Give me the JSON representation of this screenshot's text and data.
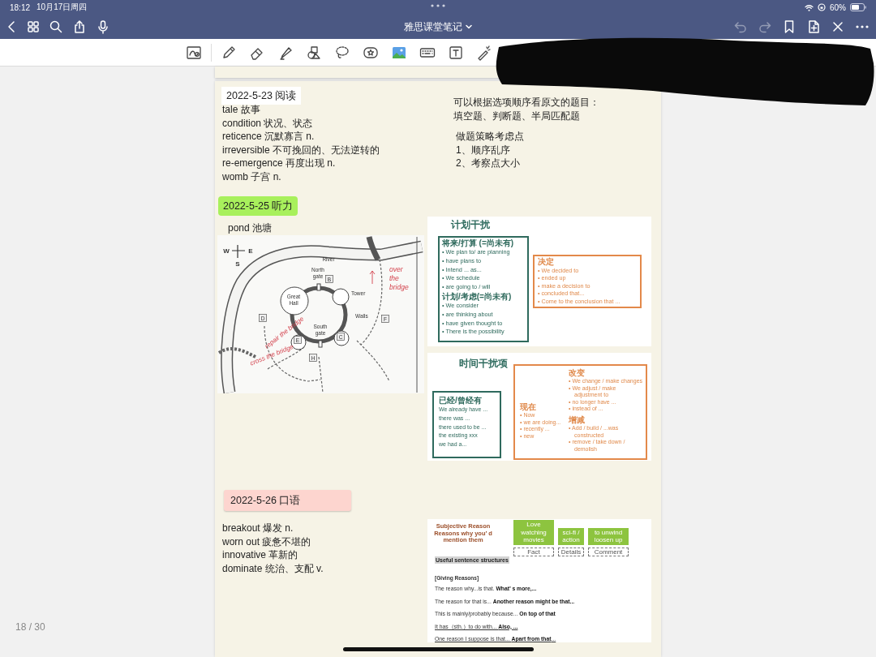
{
  "status_bar": {
    "time": "18:12",
    "date": "10月17日周四",
    "battery": "60%"
  },
  "nav_bar": {
    "title": "雅思课堂笔记",
    "undo": {
      "disabled": true
    },
    "redo": {
      "disabled": true
    }
  },
  "page_counter": "18 / 30",
  "reading": {
    "heading": "2022-5-23 阅读",
    "vocab": [
      "tale 故事",
      "condition 状况、状态",
      "reticence 沉默寡言 n.",
      "irreversible 不可挽回的、无法逆转的",
      "re-emergence 再度出现 n.",
      "womb 子宫 n."
    ],
    "tips": [
      "可以根据选项顺序看原文的题目：",
      "填空题、判断题、半局匹配题"
    ],
    "strategy": [
      "做题策略考虑点",
      "1、顺序乱序",
      "2、考察点大小"
    ]
  },
  "listening": {
    "heading": "2022-5-25 听力",
    "vocab": [
      "pond 池塘"
    ],
    "map": {
      "compass": [
        "W",
        "E",
        "S"
      ],
      "labels": [
        "River",
        "North gate",
        "Great Hall",
        "Tower",
        "Walls",
        "South gate"
      ],
      "markers": [
        "B",
        "C",
        "D",
        "E",
        "F",
        "H"
      ],
      "annotations": [
        "over the bridge",
        "repair the bridge",
        "cross the bridge"
      ]
    },
    "plan_slide": {
      "title": "计划干扰",
      "groups": [
        {
          "heading": "将来/打算 (=尚未有)",
          "items": [
            "• We plan to/ are planning",
            "• have plans to",
            "• Intend ... as...",
            "• We schedule",
            "• are going to / will"
          ]
        },
        {
          "heading": "计划/考虑(=尚未有)",
          "items": [
            "• We consider",
            "• are thinking about",
            "• have given thought to",
            "• There is the possibility"
          ]
        }
      ],
      "decision": {
        "heading": "决定",
        "items": [
          "•  We decided to",
          "•  ended up",
          "•  make a decision to",
          "•  concluded that...",
          "•  Come to the conclusion that ..."
        ]
      }
    },
    "time_slide": {
      "title": "时间干扰项",
      "past": {
        "heading": "已经/曾经有",
        "lines": [
          "We already have ...",
          "there was ...",
          "there used to be ...",
          "the existing xxx",
          "we had a..."
        ]
      },
      "present": {
        "heading": "现在",
        "items": [
          "•  Now",
          "•  we are doing...",
          "•  recently ...",
          "•  new"
        ]
      },
      "change": {
        "heading": "改变",
        "items": [
          "•  We change / make changes",
          "•  We adjust / make adjustment to",
          "•  no longer have ...",
          "•  instead of ..."
        ]
      },
      "increase_decrease": {
        "heading": "增减",
        "items": [
          "•  Add / build / ...was constructed",
          "•  remove / take down / demolish"
        ]
      }
    }
  },
  "speaking": {
    "heading": "2022-5-26 口语",
    "vocab": [
      "breakout 爆发 n.",
      "worn out 疲惫不堪的",
      "innovative 革新的",
      "dominate 统治、支配 v."
    ],
    "slide": {
      "subjective": [
        "Subjective Reason",
        "Reasons why you’ d mention them"
      ],
      "tiles": [
        {
          "text": "Love watching movies",
          "label": "Fact"
        },
        {
          "text": "sci-fi / action",
          "label": "Details"
        },
        {
          "text": "to unwind loosen up",
          "label": "Comment"
        }
      ],
      "structures_heading": "Useful sentence structures",
      "section": "[Giving Reasons]",
      "sentences": [
        {
          "text": "The reason why...is that. **What’ s more,...**",
          "underlined": false
        },
        {
          "text": "The reason for that is... **Another reason might be that...**",
          "underlined": false
        },
        {
          "text": "This is mainly/probably because... **On top of that**",
          "underlined": false
        },
        {
          "text": "It has（sth.）to do with... **Also, ...**",
          "underlined": true
        },
        {
          "text": "One reason I suppose is that... **Apart from that**...",
          "underlined": true
        }
      ]
    }
  }
}
